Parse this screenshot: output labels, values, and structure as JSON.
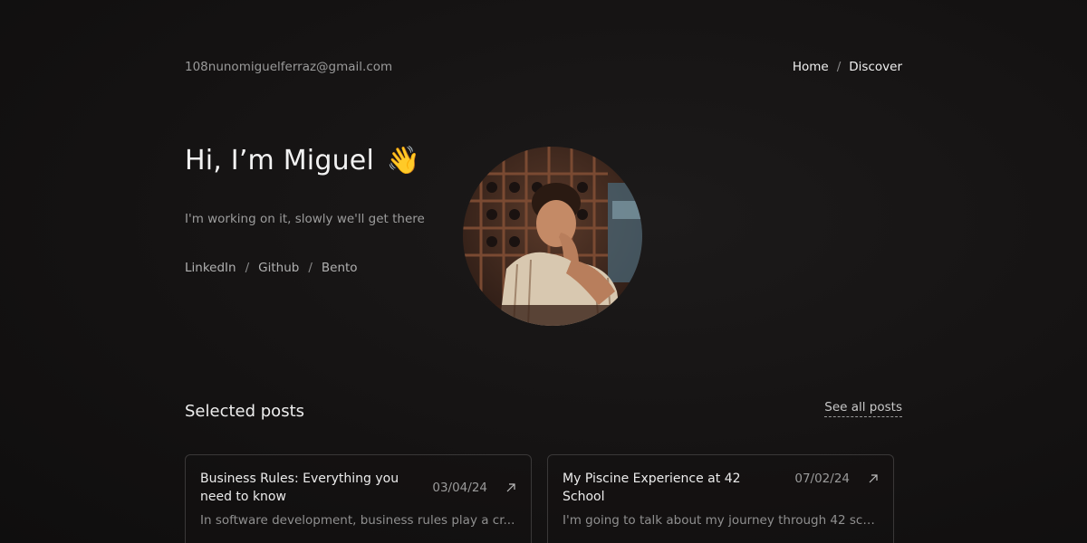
{
  "header": {
    "email": "108nunomiguelferraz@gmail.com",
    "nav": [
      {
        "label": "Home"
      },
      {
        "label": "Discover"
      }
    ],
    "nav_separator": "/"
  },
  "hero": {
    "title": "Hi, I’m Miguel",
    "emoji": "👋",
    "tagline": "I'm working on it, slowly we'll get there",
    "social": [
      {
        "label": "LinkedIn"
      },
      {
        "label": "Github"
      },
      {
        "label": "Bento"
      }
    ],
    "social_separator": "/"
  },
  "posts": {
    "section_title": "Selected posts",
    "see_all_label": "See all posts",
    "items": [
      {
        "title": "Business Rules: Everything you need to know",
        "date": "03/04/24",
        "excerpt": "In software development, business rules play a cr..."
      },
      {
        "title": "My Piscine Experience at 42 School",
        "date": "07/02/24",
        "excerpt": "I'm going to talk about my journey through 42 sch..."
      }
    ]
  },
  "colors": {
    "background": "#141212",
    "text_primary": "#f0f0f0",
    "text_muted": "#9a9a9a",
    "card_border": "#3a3838"
  },
  "icons": {
    "card_arrow": "arrow-up-right-icon"
  }
}
